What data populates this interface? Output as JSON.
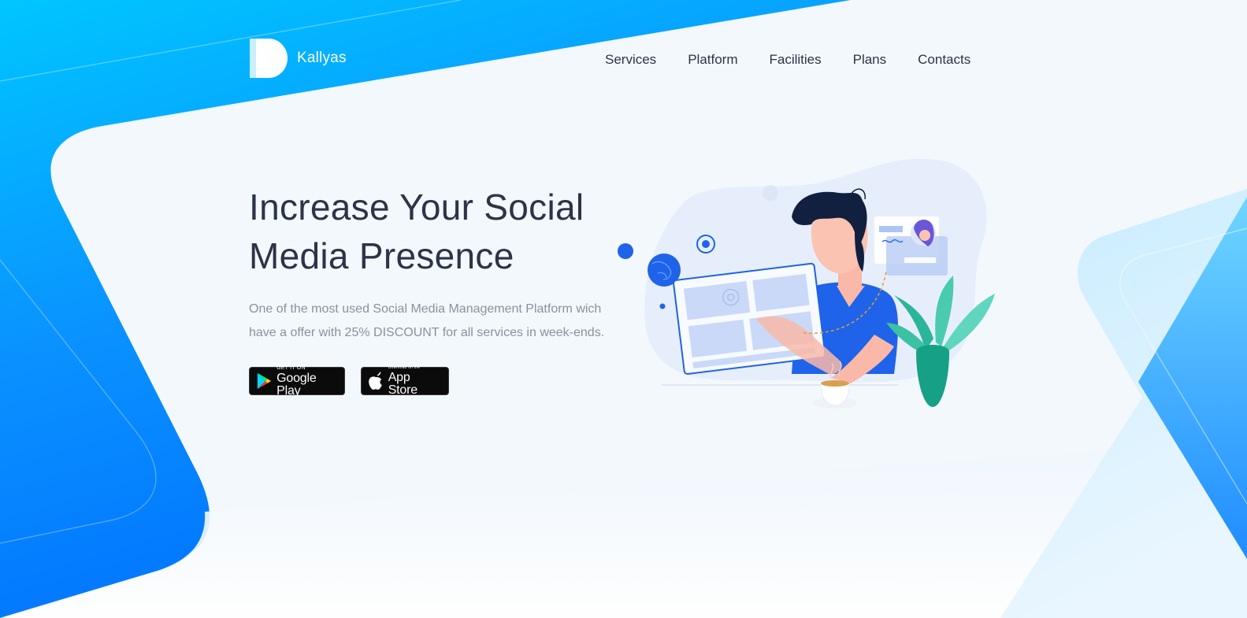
{
  "brand": {
    "name": "Kallyas"
  },
  "nav": {
    "items": [
      {
        "label": "Services"
      },
      {
        "label": "Platform"
      },
      {
        "label": "Facilities"
      },
      {
        "label": "Plans"
      },
      {
        "label": "Contacts"
      }
    ]
  },
  "hero": {
    "title_line1": "Increase Your Social",
    "title_line2": "Media Presence",
    "description_line1": "One of the most used Social Media Management Platform wich",
    "description_line2": "have a offer with 25% DISCOUNT for all services in week-ends."
  },
  "stores": {
    "google_play": {
      "small": "GET IT ON",
      "big": "Google Play",
      "icon": "google-play-icon"
    },
    "app_store": {
      "small": "Download on the",
      "big": "App Store",
      "icon": "apple-icon"
    }
  },
  "colors": {
    "accent_blue": "#0077ff",
    "sky_blue": "#00c6ff",
    "text_dark": "#2b3448",
    "text_muted": "#8a91a0",
    "illustration_blue": "#1e63e9",
    "plant_teal": "#2bb59a"
  },
  "illustration": {
    "name": "person-with-tablet-illustration"
  }
}
